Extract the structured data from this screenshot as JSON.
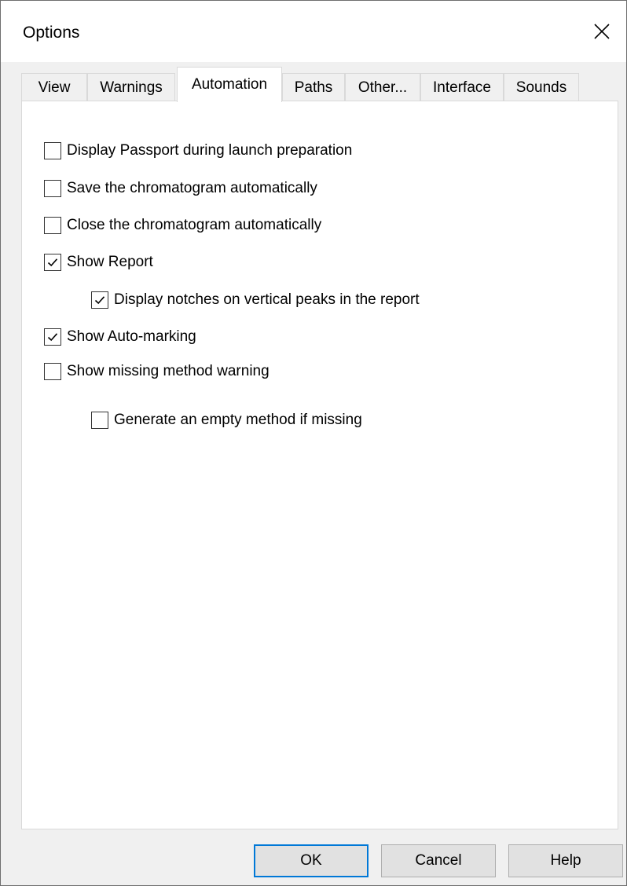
{
  "dialog": {
    "title": "Options",
    "close_icon": "close-icon"
  },
  "tabs": [
    {
      "label": "View",
      "active": false
    },
    {
      "label": "Warnings",
      "active": false
    },
    {
      "label": "Automation",
      "active": true
    },
    {
      "label": "Paths",
      "active": false
    },
    {
      "label": "Other...",
      "active": false
    },
    {
      "label": "Interface",
      "active": false
    },
    {
      "label": "Sounds",
      "active": false
    }
  ],
  "options": [
    {
      "label": "Display Passport during launch preparation",
      "checked": false
    },
    {
      "label": "Save the chromatogram automatically",
      "checked": false
    },
    {
      "label": "Close the chromatogram automatically",
      "checked": false
    },
    {
      "label": "Show Report",
      "checked": true
    },
    {
      "label": "Display notches on vertical peaks in the report",
      "checked": true
    },
    {
      "label": "Show Auto-marking",
      "checked": true
    },
    {
      "label": "Show missing method warning",
      "checked": false
    },
    {
      "label": "Generate an empty method if missing",
      "checked": false
    }
  ],
  "buttons": {
    "ok": "OK",
    "cancel": "Cancel",
    "help": "Help"
  },
  "colors": {
    "default_button_border": "#0078d7",
    "tab_border": "#d9d9d9",
    "dialog_background": "#f0f0f0"
  }
}
